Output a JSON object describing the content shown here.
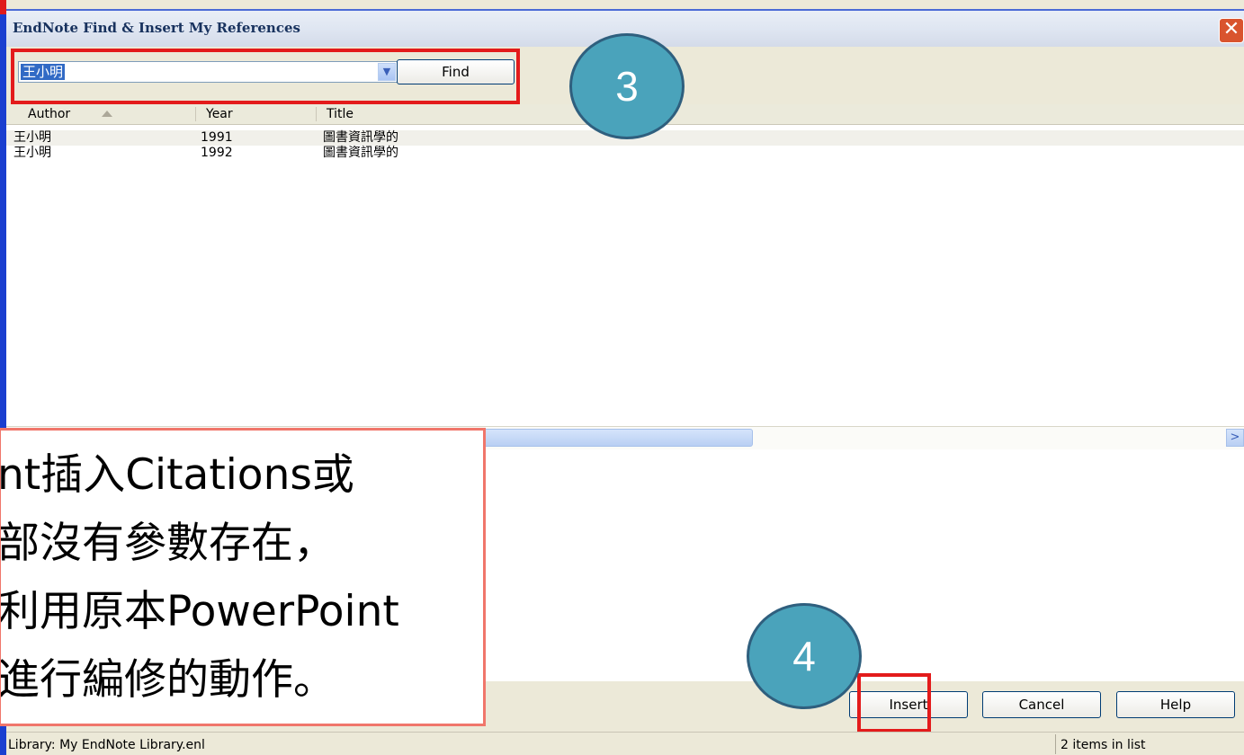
{
  "window": {
    "title": "EndNote Find & Insert My References",
    "close_glyph": "✕"
  },
  "search": {
    "query": "王小明",
    "find_label": "Find"
  },
  "list": {
    "columns": [
      "Author",
      "Year",
      "Title"
    ],
    "rows": [
      {
        "author": "王小明",
        "year": "1991",
        "title": "圖書資訊學的"
      },
      {
        "author": "王小明",
        "year": "1992",
        "title": "圖書資訊學的"
      }
    ]
  },
  "buttons": {
    "insert": "Insert",
    "cancel": "Cancel",
    "help": "Help"
  },
  "status": {
    "library": "Library: My EndNote Library.enl",
    "count": "2 items in list"
  },
  "annotations": {
    "step3": "3",
    "step4": "4",
    "callout_lines": [
      "nt插入Citations或",
      "部沒有參數存在，",
      "利用原本PowerPoint",
      "進行編修的動作。"
    ]
  },
  "colors": {
    "highlight": "#e31b1b",
    "circle": "#4aa3bb",
    "callout_border": "#f0766b"
  }
}
